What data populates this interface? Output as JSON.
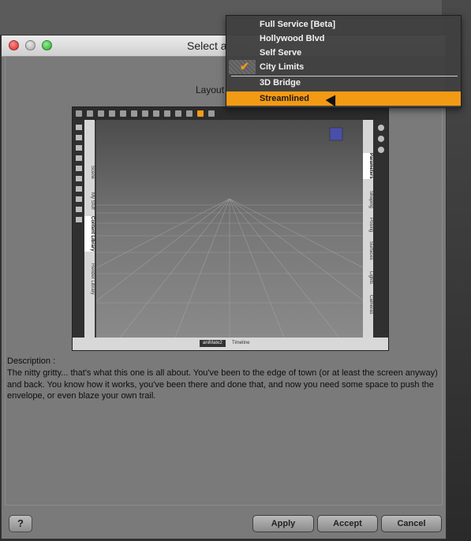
{
  "window": {
    "title": "Select a"
  },
  "layout": {
    "label": "Layout :"
  },
  "menu": {
    "items": [
      {
        "label": "Full Service [Beta]"
      },
      {
        "label": "Hollywood Blvd"
      },
      {
        "label": "Self Serve"
      },
      {
        "label": "City Limits",
        "checked": true
      },
      {
        "label": "3D Bridge"
      },
      {
        "label": "Streamlined",
        "highlighted": true
      }
    ],
    "highlight_color": "#f39a15"
  },
  "preview": {
    "left_tabs": [
      "Scene",
      "My Stuff",
      "Content Library",
      "Render Library"
    ],
    "right_tabs": [
      "Parameters",
      "Shaping",
      "Posing",
      "Surfaces",
      "Lights",
      "Cameras"
    ],
    "bottom_tabs": [
      "aniMate2",
      "Timeline"
    ]
  },
  "description": {
    "title": "Description :",
    "body": "The nitty gritty... that's what this one is all about. You've been to the edge of town (or at least the screen anyway) and back. You know how it works, you've been there and done that, and now you need some space to push the envelope, or even blaze your own trail."
  },
  "buttons": {
    "help": "?",
    "apply": "Apply",
    "accept": "Accept",
    "cancel": "Cancel"
  }
}
